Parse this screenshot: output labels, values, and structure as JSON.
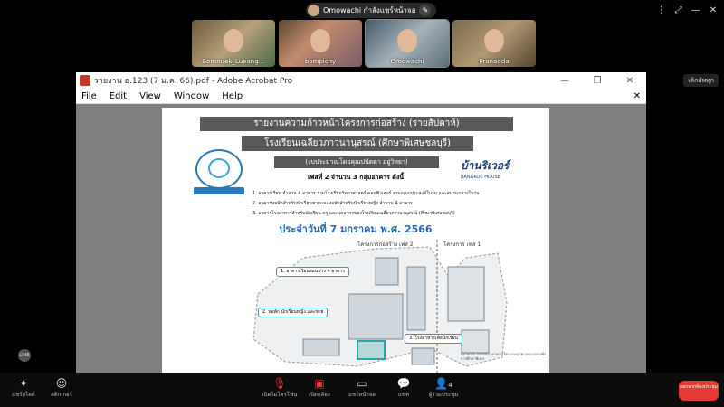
{
  "meeting": {
    "presenter_name": "Omowachi กำลังแชร์หน้าจอ",
    "leave_label": "ออกจากห้องประชุม",
    "participants": [
      {
        "name": "Somnuek_Lueang..."
      },
      {
        "name": "bompichy"
      },
      {
        "name": "Omowachi"
      },
      {
        "name": "Pranadda"
      }
    ],
    "more_button": "เลิกอัพทุก",
    "controls": [
      {
        "label": "แชร์สไลด์",
        "icon": "sparkle-icon"
      },
      {
        "label": "สติกเกอร์",
        "icon": "smile-icon"
      },
      {
        "label": "เปิดไมโครโฟน",
        "icon": "mic-off-icon"
      },
      {
        "label": "เปิดกล้อง",
        "icon": "camera-off-icon"
      },
      {
        "label": "แชร์หน้าจอ",
        "icon": "screen-share-icon"
      },
      {
        "label": "แชท",
        "icon": "chat-icon"
      },
      {
        "label": "ผู้ร่วมประชุม",
        "icon": "people-icon",
        "count": "4"
      }
    ],
    "line_badge": "LINE"
  },
  "acrobat": {
    "title": "รายงาน อ.123 (7 ม.ค. 66).pdf - Adobe Acrobat Pro",
    "menu": [
      "File",
      "Edit",
      "View",
      "Window",
      "Help"
    ]
  },
  "document": {
    "heading1": "รายงานความก้าวหน้าโครงการก่อสร้าง (รายสัปดาห์)",
    "heading2": "โรงเรียนเฉลียวภาวนานุสรณ์ (ศึกษาพิเศษชลบุรี)",
    "heading3": "(งบประมาณโดยคุณปนัดดา อยู่วิทยา)",
    "phase": "เฟสที่ 2  จำนวน 3 กลุ่มอาคาร ดังนี้",
    "items": [
      "1. อาคารเรียน จำนวน 4 อาคาร รวมโรงเรียนวิทยาศาสตร์ คอมพิวเตอร์ งานอเนกประสงค์ในร่ม และสนามกลางในร่ม",
      "2. อาคารหอพักสำหรับนักเรียนชายและหอพักสำหรับนักเรียนหญิง จำนวน 4 อาคาร",
      "3. อาคารโรงอาหารสำหรับนักเรียน ครู และบุคลากรของโรงเรียนเฉลียวภาวนานุสรณ์ (ศึกษาพิเศษชลบุรี)"
    ],
    "date": "ประจำวันที่ 7 มกราคม พ.ศ. 2566",
    "zone2": "โครงการก่อสร้าง เฟส 2",
    "zone1": "โครงการ เฟส 1",
    "tags": [
      "1. อาคารเรียนสอนช่าง 4 อาคาร",
      "2. หอพัก นักเรียนหญิง และชาย",
      "3. โรงอาหารเพื่อนักเรียน"
    ],
    "logo_right_main": "บ้านริเวอร์",
    "logo_right_sub": "BANGKOK HOUSE",
    "footnote": "ชื่อโครงการก่อสร้างอาคารเรียนและอาคารประกอบเพื่อการศึกษาพิเศษ"
  }
}
